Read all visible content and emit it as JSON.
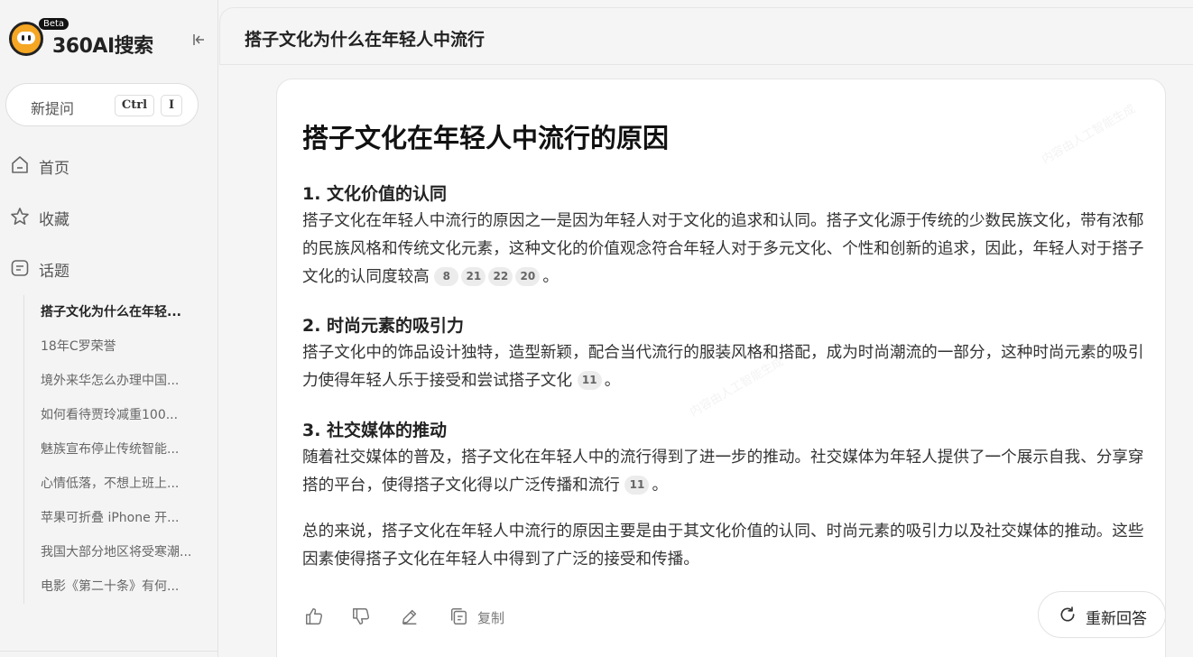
{
  "brand": {
    "name": "360AI搜索",
    "badge": "Beta"
  },
  "sidebar": {
    "new_question": {
      "label": "新提问",
      "shortcut_ctrl": "Ctrl",
      "shortcut_key": "I"
    },
    "nav": [
      {
        "label": "首页",
        "icon": "home-icon"
      },
      {
        "label": "收藏",
        "icon": "star-icon"
      },
      {
        "label": "话题",
        "icon": "topic-icon"
      }
    ],
    "topics": [
      "搭子文化为什么在年轻...",
      "18年C罗荣誉",
      "境外来华怎么办理中国...",
      "如何看待贾玲减重100...",
      "魅族宣布停止传统智能...",
      "心情低落，不想上班上...",
      "苹果可折叠 iPhone 开...",
      "我国大部分地区将受寒潮...",
      "电影《第二十条》有何..."
    ]
  },
  "header": {
    "title": "搭子文化为什么在年轻人中流行"
  },
  "answer": {
    "title": "搭子文化在年轻人中流行的原因",
    "sections": [
      {
        "heading": "1. 文化价值的认同",
        "text": "搭子文化在年轻人中流行的原因之一是因为年轻人对于文化的追求和认同。搭子文化源于传统的少数民族文化，带有浓郁的民族风格和传统文化元素，这种文化的价值观念符合年轻人对于多元文化、个性和创新的追求，因此，年轻人对于搭子文化的认同度较高",
        "citations": [
          "8",
          "21",
          "22",
          "20"
        ]
      },
      {
        "heading": "2. 时尚元素的吸引力",
        "text": "搭子文化中的饰品设计独特，造型新颖，配合当代流行的服装风格和搭配，成为时尚潮流的一部分，这种时尚元素的吸引力使得年轻人乐于接受和尝试搭子文化",
        "citations": [
          "11"
        ]
      },
      {
        "heading": "3. 社交媒体的推动",
        "text": "随着社交媒体的普及，搭子文化在年轻人中的流行得到了进一步的推动。社交媒体为年轻人提供了一个展示自我、分享穿搭的平台，使得搭子文化得以广泛传播和流行",
        "citations": [
          "11"
        ]
      }
    ],
    "end_mark": "。",
    "summary": "总的来说，搭子文化在年轻人中流行的原因主要是由于其文化价值的认同、时尚元素的吸引力以及社交媒体的推动。这些因素使得搭子文化在年轻人中得到了广泛的接受和传播。"
  },
  "actions": {
    "copy_label": "复制",
    "regenerate_label": "重新回答"
  }
}
